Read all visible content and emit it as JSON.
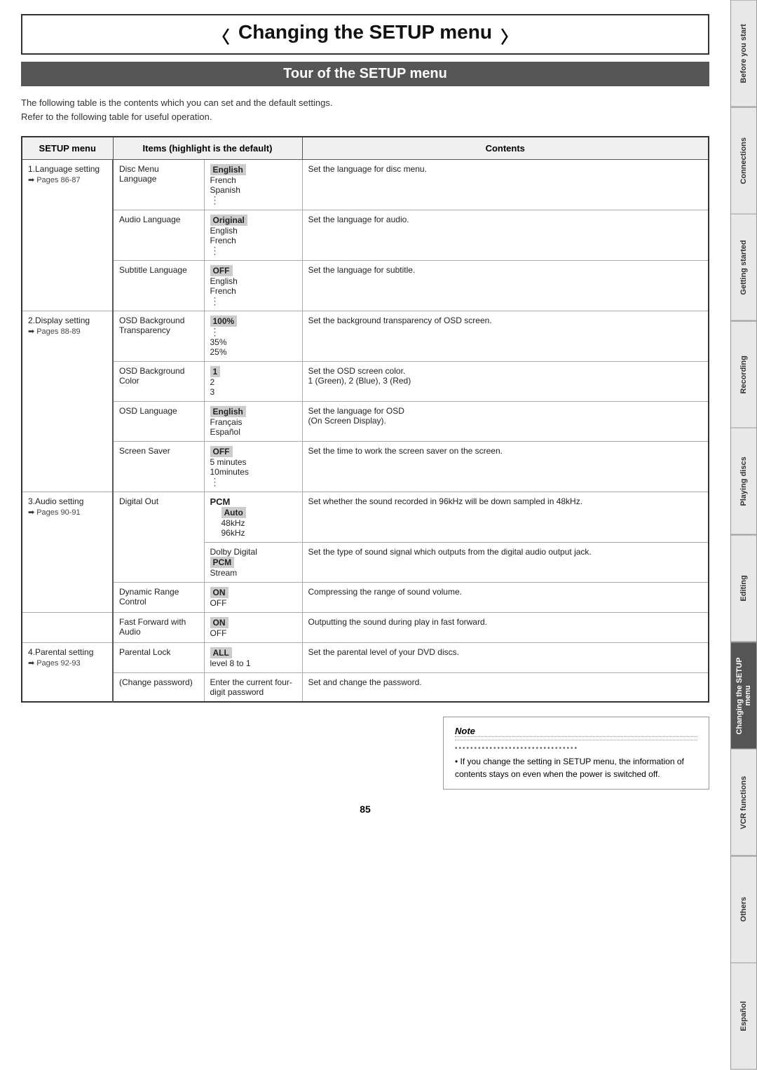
{
  "page": {
    "title": "Changing the SETUP menu",
    "subtitle": "Tour of the SETUP menu",
    "intro_line1": "The following table is the contents which you can set and the default settings.",
    "intro_line2": "Refer to the following table for useful operation.",
    "page_number": "85"
  },
  "table": {
    "headers": [
      "SETUP menu",
      "Items (highlight is the default)",
      "Contents"
    ],
    "sections": [
      {
        "setup_name": "1.Language setting",
        "setup_pages": "Pages 86-87",
        "rows": [
          {
            "item": "Disc Menu Language",
            "values": [
              {
                "text": "English",
                "highlighted": true
              },
              {
                "text": "French",
                "highlighted": false
              },
              {
                "text": "Spanish",
                "highlighted": false
              },
              {
                "text": "⋮",
                "dots": true
              }
            ],
            "contents": "Set the language for disc menu."
          },
          {
            "item": "Audio Language",
            "values": [
              {
                "text": "Original",
                "highlighted": true
              },
              {
                "text": "English",
                "highlighted": false
              },
              {
                "text": "French",
                "highlighted": false
              },
              {
                "text": "⋮",
                "dots": true
              }
            ],
            "contents": "Set the language for audio."
          },
          {
            "item": "Subtitle Language",
            "values": [
              {
                "text": "OFF",
                "highlighted": true
              },
              {
                "text": "English",
                "highlighted": false
              },
              {
                "text": "French",
                "highlighted": false
              },
              {
                "text": "⋮",
                "dots": true
              }
            ],
            "contents": "Set the language for subtitle."
          }
        ]
      },
      {
        "setup_name": "2.Display setting",
        "setup_pages": "Pages 88-89",
        "rows": [
          {
            "item": "OSD Background Transparency",
            "values": [
              {
                "text": "100%",
                "highlighted": true
              },
              {
                "text": "⋮",
                "dots": true
              },
              {
                "text": "35%",
                "highlighted": false
              },
              {
                "text": "25%",
                "highlighted": false
              }
            ],
            "contents": "Set the background transparency of OSD screen."
          },
          {
            "item": "OSD Background Color",
            "values": [
              {
                "text": "1",
                "highlighted": true
              },
              {
                "text": "2",
                "highlighted": false
              },
              {
                "text": "3",
                "highlighted": false
              }
            ],
            "contents": "Set the OSD screen color.\n1 (Green), 2 (Blue), 3 (Red)"
          },
          {
            "item": "OSD Language",
            "values": [
              {
                "text": "English",
                "highlighted": true
              },
              {
                "text": "Français",
                "highlighted": false
              },
              {
                "text": "Español",
                "highlighted": false
              }
            ],
            "contents": "Set the language for OSD\n(On Screen Display)."
          },
          {
            "item": "Screen Saver",
            "values": [
              {
                "text": "OFF",
                "highlighted": true
              },
              {
                "text": "5 minutes",
                "highlighted": false
              },
              {
                "text": "10minutes",
                "highlighted": false
              },
              {
                "text": "⋮",
                "dots": true
              }
            ],
            "contents": "Set the time to work the screen saver on the screen."
          }
        ]
      },
      {
        "setup_name": "3.Audio setting",
        "setup_pages": "Pages 90-91",
        "rows": [
          {
            "item": "Digital Out",
            "values_complex": {
              "type": "digital_out",
              "pcm_bold": "PCM",
              "sub": [
                {
                  "text": "Auto",
                  "indent": true,
                  "highlighted": true
                },
                {
                  "text": "48kHz",
                  "indent": true,
                  "highlighted": false
                },
                {
                  "text": "96kHz",
                  "indent": true,
                  "highlighted": false
                }
              ],
              "dolby": "Dolby Digital",
              "dolby_sub": [
                {
                  "text": "PCM",
                  "highlighted": true
                },
                {
                  "text": "Stream",
                  "highlighted": false
                }
              ]
            },
            "contents_multi": [
              "Set whether the sound recorded in 96kHz will be down sampled in 48kHz.",
              "Set the type of sound signal which outputs from the digital audio output jack."
            ]
          },
          {
            "item": "Dynamic Range Control",
            "values": [
              {
                "text": "ON",
                "highlighted": true
              },
              {
                "text": "OFF",
                "highlighted": false
              }
            ],
            "contents": "Compressing the range of sound volume."
          },
          {
            "item": "Fast Forward with Audio",
            "values": [
              {
                "text": "ON",
                "highlighted": true
              },
              {
                "text": "OFF",
                "highlighted": false
              }
            ],
            "contents": "Outputting the sound during play in fast forward."
          }
        ]
      },
      {
        "setup_name": "4.Parental setting",
        "setup_pages": "Pages 92-93",
        "rows": [
          {
            "item": "Parental Lock",
            "values": [
              {
                "text": "ALL",
                "highlighted": true
              },
              {
                "text": "level 8 to 1",
                "highlighted": false
              }
            ],
            "contents": "Set the parental level of your DVD discs."
          },
          {
            "item": "(Change password)",
            "values": [
              {
                "text": "Enter the current four-digit password",
                "highlighted": false
              }
            ],
            "contents": "Set and change the password."
          }
        ]
      }
    ]
  },
  "note": {
    "title": "Note",
    "dots": "••••••••••••••••••••••••••••••••",
    "text": "• If you change the setting in SETUP menu, the information of contents stays on even when the power is switched off."
  },
  "sidebar": {
    "tabs": [
      {
        "label": "Before you start",
        "active": false
      },
      {
        "label": "Connections",
        "active": false
      },
      {
        "label": "Getting started",
        "active": false
      },
      {
        "label": "Recording",
        "active": false
      },
      {
        "label": "Playing discs",
        "active": false
      },
      {
        "label": "Editing",
        "active": false
      },
      {
        "label": "Changing the SETUP menu",
        "active": true
      },
      {
        "label": "VCR functions",
        "active": false
      },
      {
        "label": "Others",
        "active": false
      },
      {
        "label": "Español",
        "active": false
      }
    ]
  }
}
